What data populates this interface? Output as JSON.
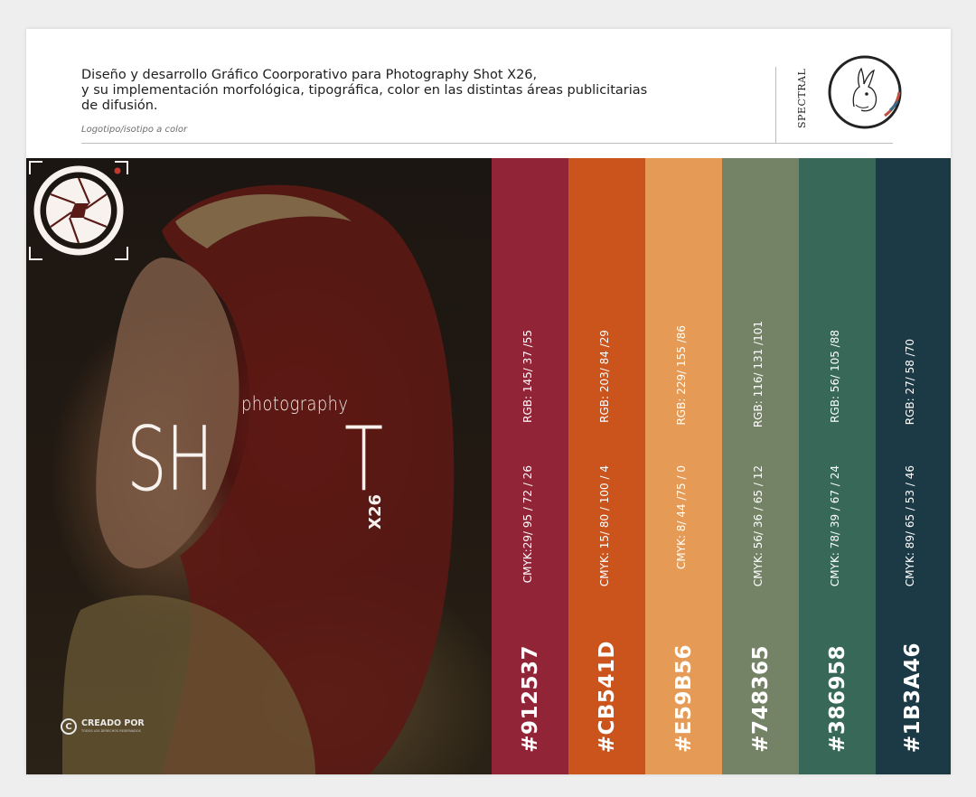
{
  "header": {
    "title": "Diseño  y desarrollo Gráfico Coorporativo para Photography Shot X26,\ny su implementación morfológica, tipográfica, color en las distintas áreas publicitarias\nde difusión.",
    "subtitle": "Logotipo/isotipo a color",
    "brand": "SPECTRAL"
  },
  "logo": {
    "word_top": "photography",
    "word_left": "SH",
    "word_right": "T",
    "badge": "X26",
    "emblem_icon": "rabbit-icon",
    "aperture_icon": "camera-aperture-icon"
  },
  "credit": {
    "label": "CREADO POR",
    "small_line": "TODOS LOS DERECHOS RESERVADOS",
    "icon": "copyright-icon"
  },
  "swatches": [
    {
      "hex": "#912537",
      "cmyk": "CMYK:29/ 95 / 72 / 26",
      "rgb": "RGB: 145/ 37 /55",
      "color": "#912537"
    },
    {
      "hex": "#CB541D",
      "cmyk": "CMYK: 15/ 80 / 100 / 4",
      "rgb": "RGB: 203/ 84 /29",
      "color": "#CB541D"
    },
    {
      "hex": "#E59B56",
      "cmyk": "CMYK: 8/ 44 /75 / 0",
      "rgb": "RGB: 229/ 155 /86",
      "color": "#E59B56"
    },
    {
      "hex": "#748365",
      "cmyk": "CMYK: 56/ 36 / 65 / 12",
      "rgb": "RGB: 116/ 131 /101",
      "color": "#748365"
    },
    {
      "hex": "#386958",
      "cmyk": "CMYK: 78/ 39 / 67 / 24",
      "rgb": "RGB: 56/ 105 /88",
      "color": "#386958"
    },
    {
      "hex": "#1B3A46",
      "cmyk": "CMYK: 89/ 65 / 53 / 46",
      "rgb": "RGB: 27/ 58 /70",
      "color": "#1B3A46"
    }
  ]
}
